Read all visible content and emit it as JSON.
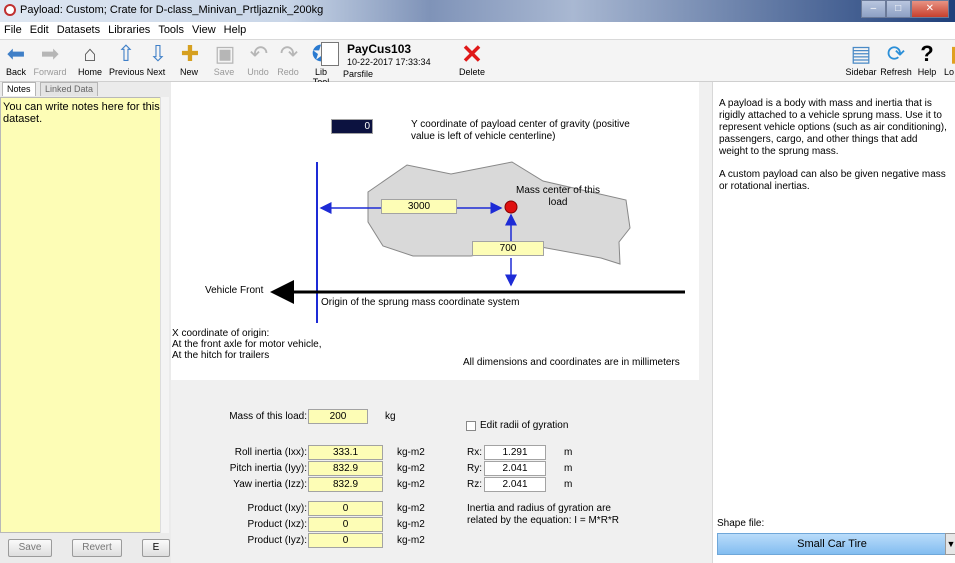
{
  "window": {
    "title": "Payload: Custom;  Crate for D-class_Minivan_Prtljaznik_200kg",
    "controls": [
      "–",
      "□",
      "✕"
    ]
  },
  "menu": [
    "File",
    "Edit",
    "Datasets",
    "Libraries",
    "Tools",
    "View",
    "Help"
  ],
  "toolbar": {
    "back": "Back",
    "forward": "Forward",
    "home": "Home",
    "previous": "Previous",
    "next": "Next",
    "new": "New",
    "save": "Save",
    "undo": "Undo",
    "redo": "Redo",
    "libtool": "Lib Tool",
    "parsfile": "Parsfile",
    "dataset_name": "PayCus103",
    "dataset_date": "10-22-2017 17:33:34",
    "delete": "Delete",
    "sidebar": "Sidebar",
    "refresh": "Refresh",
    "help": "Help",
    "lo": "Lo"
  },
  "left": {
    "tabs": [
      "Notes",
      "Linked Data"
    ],
    "notes": "You can write notes here for this dataset.",
    "save": "Save",
    "revert": "Revert",
    "e": "E"
  },
  "diagram": {
    "y_value": "0",
    "y_label": "Y coordinate of payload center of gravity (positive value is left of vehicle centerline)",
    "mass_center": "Mass center of this load",
    "x_value": "3000",
    "z_value": "700",
    "vehicle_front": "Vehicle Front",
    "origin": "Origin of the sprung mass coordinate system",
    "x_origin": [
      "X coordinate of origin:",
      "At the front axle for motor vehicle,",
      "At the hitch for trailers"
    ],
    "units_note": "All dimensions and coordinates are in millimeters"
  },
  "form": {
    "mass": {
      "label": "Mass of this load:",
      "value": "200",
      "unit": "kg"
    },
    "inertia": [
      {
        "label": "Roll inertia (Ixx):",
        "value": "333.1",
        "unit": "kg-m2"
      },
      {
        "label": "Pitch inertia (Iyy):",
        "value": "832.9",
        "unit": "kg-m2"
      },
      {
        "label": "Yaw inertia (Izz):",
        "value": "832.9",
        "unit": "kg-m2"
      }
    ],
    "product": [
      {
        "label": "Product (Ixy):",
        "value": "0",
        "unit": "kg-m2"
      },
      {
        "label": "Product (Ixz):",
        "value": "0",
        "unit": "kg-m2"
      },
      {
        "label": "Product (Iyz):",
        "value": "0",
        "unit": "kg-m2"
      }
    ],
    "edit_radii": "Edit radii of gyration",
    "radii": [
      {
        "label": "Rx:",
        "value": "1.291",
        "unit": "m"
      },
      {
        "label": "Ry:",
        "value": "2.041",
        "unit": "m"
      },
      {
        "label": "Rz:",
        "value": "2.041",
        "unit": "m"
      }
    ],
    "relation": "Inertia and radius of gyration are related by the equation: I = M*R*R"
  },
  "help": [
    "A payload is a body with mass and inertia that is rigidly attached to a vehicle sprung mass. Use it to represent vehicle options (such as air conditioning), passengers, cargo, and other things that add weight to the sprung mass.",
    "A custom payload can also be given negative mass or rotational inertias."
  ],
  "shape": {
    "label": "Shape file:",
    "value": "Small Car Tire"
  },
  "colors": {
    "yellow_field": "#fdfdb6",
    "arrow_blue": "#1d2bd6",
    "mass_dot": "#e01010",
    "shape_button": "#9ccbf4"
  }
}
